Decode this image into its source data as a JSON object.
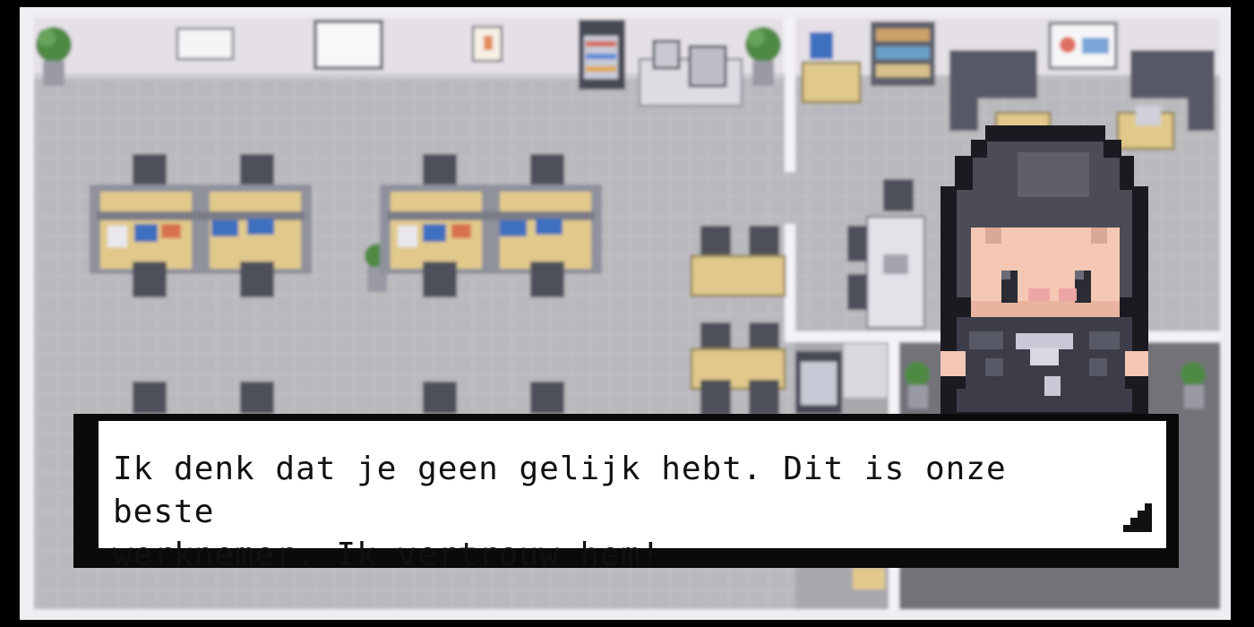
{
  "dialog": {
    "line1": "Ik denk dat je geen gelijk hebt. Dit is onze beste",
    "line2": "werknemer. Ik vertrouw hem!"
  },
  "icons": {
    "continue": "continue-arrow-icon"
  },
  "colors": {
    "floor": "#b9b9bd",
    "wall": "#e4e0e6",
    "desk": "#e1c98c",
    "chair": "#4d4f5a",
    "hair": "#4b4c55",
    "skin": "#f4c8b4",
    "suit": "#3c3d48",
    "dialog_bg": "#ffffff",
    "dialog_border": "#0a0a0a"
  }
}
